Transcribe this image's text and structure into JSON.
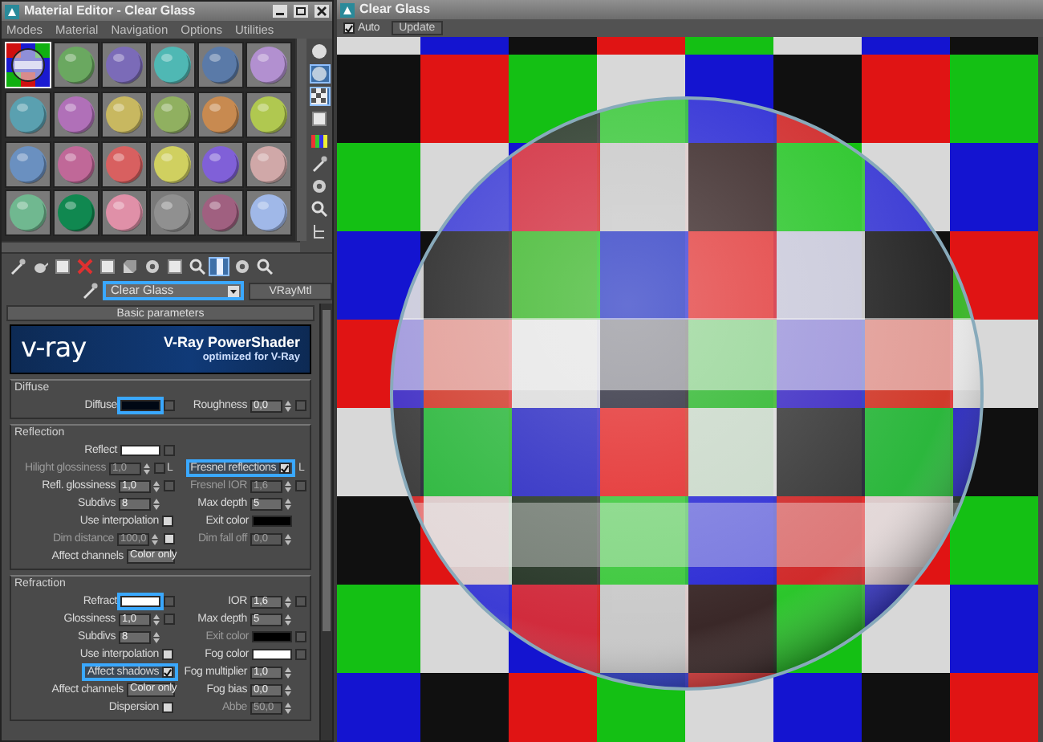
{
  "editor": {
    "title": "Material Editor - Clear Glass",
    "menus": [
      "Modes",
      "Material",
      "Navigation",
      "Options",
      "Utilities"
    ],
    "slots": [
      {
        "kind": "scene",
        "selected": true
      },
      {
        "kind": "sphere",
        "color": "#6aa860",
        "selected": false
      },
      {
        "kind": "sphere",
        "color": "#7b6bb8",
        "selected": false
      },
      {
        "kind": "sphere",
        "color": "#4fb8b4",
        "selected": false
      },
      {
        "kind": "sphere",
        "color": "#5a7aa8",
        "selected": false
      },
      {
        "kind": "sphere",
        "color": "#b290d0",
        "selected": false
      },
      {
        "kind": "sphere",
        "color": "#5aa0b0",
        "selected": false
      },
      {
        "kind": "sphere",
        "color": "#b070b8",
        "selected": false
      },
      {
        "kind": "sphere",
        "color": "#c8b860",
        "selected": false
      },
      {
        "kind": "sphere",
        "color": "#90b060",
        "selected": false
      },
      {
        "kind": "sphere",
        "color": "#c88a50",
        "selected": false
      },
      {
        "kind": "sphere",
        "color": "#b0c850",
        "selected": false
      },
      {
        "kind": "sphere",
        "color": "#6a90c0",
        "selected": false
      },
      {
        "kind": "sphere",
        "color": "#c06898",
        "selected": false
      },
      {
        "kind": "sphere",
        "color": "#d86060",
        "selected": false
      },
      {
        "kind": "sphere",
        "color": "#d0d060",
        "selected": false
      },
      {
        "kind": "sphere",
        "color": "#8060d8",
        "selected": false
      },
      {
        "kind": "sphere",
        "color": "#d0a8a8",
        "selected": false
      },
      {
        "kind": "sphere",
        "color": "#70b890",
        "selected": false
      },
      {
        "kind": "sphere",
        "color": "#108850",
        "selected": false
      },
      {
        "kind": "sphere",
        "color": "#e090a8",
        "selected": false
      },
      {
        "kind": "sphere",
        "color": "#909090",
        "selected": false
      },
      {
        "kind": "sphere",
        "color": "#a06080",
        "selected": false
      },
      {
        "kind": "sphere",
        "color": "#a0b8e8",
        "selected": false
      }
    ],
    "side_tools": [
      {
        "kind": "sphere",
        "selected": false
      },
      {
        "kind": "backlight",
        "selected": true
      },
      {
        "kind": "checker",
        "selected": true
      },
      {
        "kind": "square",
        "selected": false
      },
      {
        "kind": "colorbars",
        "selected": false
      },
      {
        "kind": "eyedrop",
        "selected": false
      },
      {
        "kind": "gear",
        "selected": false
      },
      {
        "kind": "magnify",
        "selected": false
      },
      {
        "kind": "tree",
        "selected": false
      }
    ],
    "tools": [
      {
        "kind": "eyedrop",
        "selected": false
      },
      {
        "kind": "teapot",
        "selected": false
      },
      {
        "kind": "square",
        "selected": false
      },
      {
        "kind": "delete",
        "selected": false
      },
      {
        "kind": "square",
        "selected": false
      },
      {
        "kind": "cube",
        "selected": false
      },
      {
        "kind": "gear",
        "selected": false
      },
      {
        "kind": "square",
        "selected": false
      },
      {
        "kind": "magnify",
        "selected": false
      },
      {
        "kind": "bar",
        "selected": true
      },
      {
        "kind": "gear",
        "selected": false
      },
      {
        "kind": "magnify",
        "selected": false
      }
    ],
    "material_name": "Clear Glass",
    "material_type": "VRayMtl",
    "rollout": "Basic parameters",
    "banner": {
      "logo": "v-ray",
      "title": "V-Ray PowerShader",
      "subtitle": "optimized for V-Ray"
    },
    "groups": [
      {
        "title": "Diffuse",
        "rows": [
          {
            "left": {
              "kind": "color",
              "label": "Diffuse",
              "color": "#000814",
              "highlighted": true,
              "map": true
            },
            "right": {
              "kind": "spinner",
              "label": "Roughness",
              "value": "0,0",
              "disabled": false,
              "map": true
            }
          }
        ]
      },
      {
        "title": "Reflection",
        "rows": [
          {
            "left": {
              "kind": "color",
              "label": "Reflect",
              "color": "#ffffff",
              "highlighted": false,
              "map": true
            }
          },
          {
            "left": {
              "kind": "spinner",
              "label": "Hilight glossiness",
              "value": "1,0",
              "disabled": true,
              "map": true,
              "lock": "L"
            },
            "right": {
              "kind": "checkbox",
              "label": "Fresnel reflections",
              "checked": true,
              "highlighted": true,
              "lock": "L"
            }
          },
          {
            "left": {
              "kind": "spinner",
              "label": "Refl. glossiness",
              "value": "1,0",
              "disabled": false,
              "map": true
            },
            "right": {
              "kind": "spinner",
              "label": "Fresnel IOR",
              "value": "1,6",
              "disabled": true,
              "map": true
            }
          },
          {
            "left": {
              "kind": "spinner",
              "label": "Subdivs",
              "value": "8",
              "disabled": false
            },
            "right": {
              "kind": "spinner",
              "label": "Max depth",
              "value": "5",
              "disabled": false
            }
          },
          {
            "left": {
              "kind": "checkbox",
              "label": "Use interpolation",
              "checked": false,
              "highlighted": false
            },
            "right": {
              "kind": "color",
              "label": "Exit color",
              "color": "#000000",
              "highlighted": false
            }
          },
          {
            "left": {
              "kind": "spinner",
              "label": "Dim distance",
              "value": "100,0",
              "disabled": true,
              "toggle": false
            },
            "right": {
              "kind": "spinner",
              "label": "Dim fall off",
              "value": "0,0",
              "disabled": true
            }
          },
          {
            "left": {
              "kind": "dropdown",
              "label": "Affect channels",
              "value": "Color only"
            }
          }
        ]
      },
      {
        "title": "Refraction",
        "rows": [
          {
            "left": {
              "kind": "color",
              "label": "Refract",
              "color": "#ffffff",
              "highlighted": true,
              "map": true
            },
            "right": {
              "kind": "spinner",
              "label": "IOR",
              "value": "1,6",
              "disabled": false,
              "map": true
            }
          },
          {
            "left": {
              "kind": "spinner",
              "label": "Glossiness",
              "value": "1,0",
              "disabled": false,
              "map": true
            },
            "right": {
              "kind": "spinner",
              "label": "Max depth",
              "value": "5",
              "disabled": false
            }
          },
          {
            "left": {
              "kind": "spinner",
              "label": "Subdivs",
              "value": "8",
              "disabled": false
            },
            "right": {
              "kind": "color",
              "label": "Exit color",
              "color": "#000000",
              "highlighted": false,
              "disabled": true,
              "map": true
            }
          },
          {
            "left": {
              "kind": "checkbox",
              "label": "Use interpolation",
              "checked": false,
              "highlighted": false
            },
            "right": {
              "kind": "color",
              "label": "Fog color",
              "color": "#ffffff",
              "highlighted": false,
              "map": true
            }
          },
          {
            "left": {
              "kind": "checkbox",
              "label": "Affect shadows",
              "checked": true,
              "highlighted": true
            },
            "right": {
              "kind": "spinner",
              "label": "Fog multiplier",
              "value": "1,0",
              "disabled": false
            }
          },
          {
            "left": {
              "kind": "dropdown",
              "label": "Affect channels",
              "value": "Color only"
            },
            "right": {
              "kind": "spinner",
              "label": "Fog bias",
              "value": "0,0",
              "disabled": false
            }
          },
          {
            "left": {
              "kind": "checkbox",
              "label": "Dispersion",
              "checked": false,
              "highlighted": false
            },
            "right": {
              "kind": "spinner",
              "label": "Abbe",
              "value": "50,0",
              "disabled": true
            }
          }
        ]
      }
    ]
  },
  "render": {
    "title": "Clear Glass",
    "auto": {
      "label": "Auto",
      "checked": true
    },
    "update_button": "Update"
  }
}
